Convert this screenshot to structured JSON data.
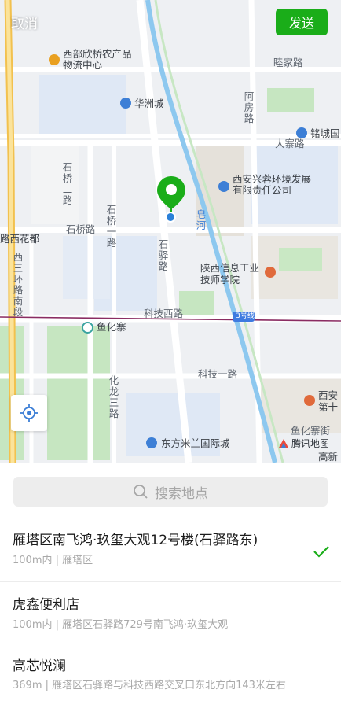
{
  "header": {
    "cancel_label": "取消",
    "send_label": "发送"
  },
  "map": {
    "labels": {
      "xibu_market": "西部欣桥农产品物流中心",
      "huazhoucheng": "华洲城",
      "suijiayu": "睦家路",
      "afanglu": "阿房路",
      "minglu": "铭城国",
      "dazhailu": "大寨路",
      "xingrong": "西安兴蓉环境发展有限责任公司",
      "shiqiaoerlu": "石桥二路",
      "shiqiaoyilu": "石桥一路",
      "shiqiaolu": "石桥路",
      "zaohe": "皂河",
      "shiyilu": "石驿路",
      "lihuadu": "路西花都",
      "xisanhuan": "西三环路南段",
      "shaanxi_xinxi": "陕西信息工业技师学院",
      "kejixilu": "科技西路",
      "line3": "3号线",
      "yuhuazhai": "鱼化寨",
      "kejiyilu": "科技一路",
      "hualongsanlu": "化龙三路",
      "xian_di": "西安第十",
      "yuhuazhaijie": "鱼化寨街",
      "dongfang_milan": "东方米兰国际城",
      "gaoxin": "高新",
      "watermark": "腾讯地图"
    },
    "colors": {
      "pin": "#1aad19",
      "river": "#8dc8ef",
      "metro": "#8a2c62"
    }
  },
  "search": {
    "placeholder": "搜索地点"
  },
  "results": [
    {
      "title": "雁塔区南飞鸿·玖玺大观12号楼(石驿路东)",
      "subtitle": "100m内 | 雁塔区",
      "selected": true
    },
    {
      "title": "虎鑫便利店",
      "subtitle": "100m内 | 雁塔区石驿路729号南飞鸿·玖玺大观",
      "selected": false
    },
    {
      "title": "高芯悦澜",
      "subtitle": "369m | 雁塔区石驿路与科技西路交叉口东北方向143米左右",
      "selected": false
    }
  ],
  "icons": {
    "search": "search-icon",
    "check": "check-icon",
    "locate": "locate-icon",
    "pin": "location-pin-icon",
    "metro": "metro-station-icon",
    "poi": "poi-icon"
  }
}
